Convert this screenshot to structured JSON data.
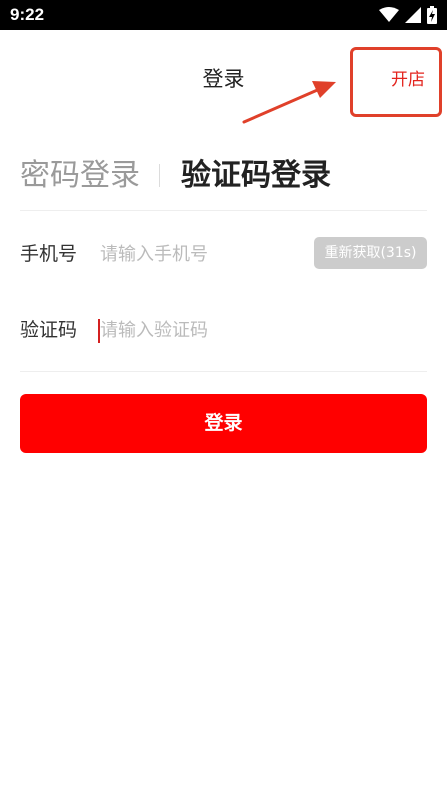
{
  "status_bar": {
    "time": "9:22",
    "icons": [
      "wifi-icon",
      "signal-icon",
      "battery-charging-icon"
    ]
  },
  "header": {
    "title": "登录",
    "open_shop_label": "开店"
  },
  "mode_tabs": {
    "password_login": "密码登录",
    "code_login": "验证码登录",
    "active": "code_login"
  },
  "form": {
    "phone": {
      "label": "手机号",
      "value": "",
      "placeholder": "请输入手机号",
      "resend_label": "重新获取(31s)"
    },
    "code": {
      "label": "验证码",
      "value": "",
      "placeholder": "请输入验证码"
    }
  },
  "login_button": {
    "label": "登录"
  },
  "colors": {
    "accent": "#ff0000",
    "highlight_box": "#e0402a",
    "open_shop_text": "#e3241e",
    "disabled_button": "#cccccc"
  }
}
